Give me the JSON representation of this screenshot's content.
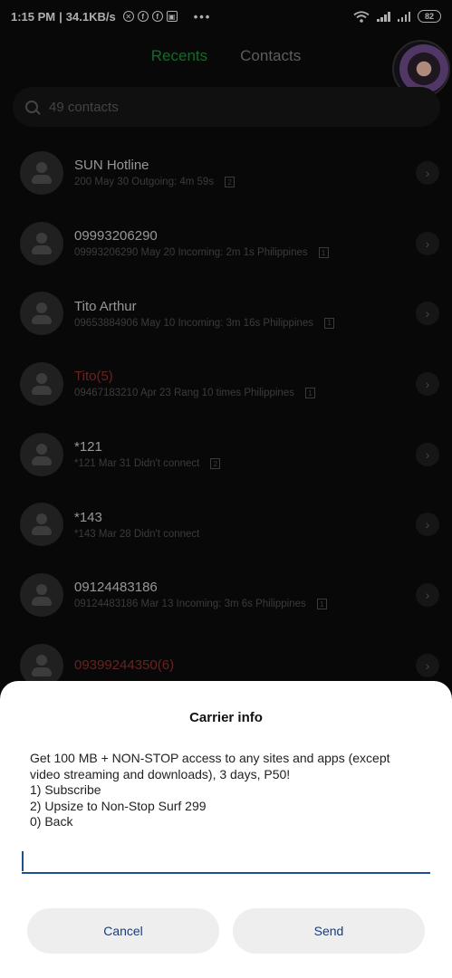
{
  "status_bar": {
    "time": "1:15 PM",
    "speed": "34.1KB/s",
    "battery": "82",
    "more": "•••",
    "icons": [
      "mute-icon",
      "facebook-icon",
      "facebook-icon",
      "shopping-bag-icon",
      "wifi-icon",
      "signal-icon",
      "signal-icon",
      "battery-icon"
    ]
  },
  "tabs": [
    {
      "label": "Recents",
      "active": true
    },
    {
      "label": "Contacts",
      "active": false
    }
  ],
  "search": {
    "placeholder": "49 contacts"
  },
  "calls": [
    {
      "name": "SUN Hotline",
      "detail": "200  May 30 Outgoing: 4m 59s",
      "sim": "2",
      "missed": false
    },
    {
      "name": "09993206290",
      "detail": "09993206290  May 20 Incoming: 2m 1s  Philippines",
      "sim": "1",
      "missed": false
    },
    {
      "name": "Tito Arthur",
      "detail": "09653884906  May 10 Incoming: 3m 16s  Philippines",
      "sim": "1",
      "missed": false
    },
    {
      "name": "Tito(5)",
      "detail": "09467183210  Apr 23 Rang 10 times  Philippines",
      "sim": "1",
      "missed": true
    },
    {
      "name": "*121",
      "detail": "*121  Mar 31 Didn't connect",
      "sim": "2",
      "missed": false
    },
    {
      "name": "*143",
      "detail": "*143  Mar 28 Didn't connect",
      "sim": "",
      "missed": false
    },
    {
      "name": "09124483186",
      "detail": "09124483186  Mar 13 Incoming: 3m 6s  Philippines",
      "sim": "1",
      "missed": false
    },
    {
      "name": "09399244350(6)",
      "detail": "",
      "sim": "",
      "missed": true
    }
  ],
  "dialog": {
    "title": "Carrier info",
    "message": "Get 100 MB + NON-STOP access to any sites and apps (except video streaming and downloads), 3 days, P50!\n1) Subscribe\n2) Upsize to Non-Stop Surf 299\n0) Back",
    "input_value": "",
    "cancel_label": "Cancel",
    "send_label": "Send"
  },
  "colors": {
    "accent_green": "#1f8a3a",
    "missed_red": "#8b2f2a",
    "button_text": "#173d7a",
    "input_underline": "#1d4f95"
  }
}
